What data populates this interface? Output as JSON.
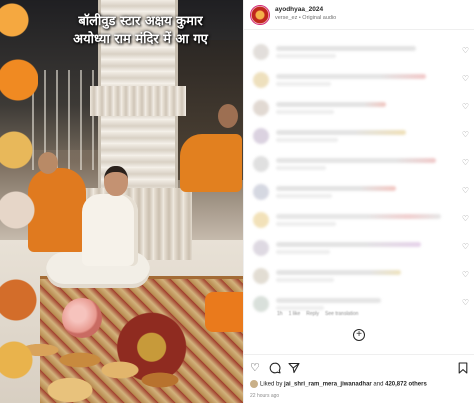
{
  "media": {
    "overlay_line1": "बॉलीवुड स्टार अक्षय कुमार",
    "overlay_line2": "अयोध्या राम मंदिर में आ गए"
  },
  "header": {
    "username": "ayodhyaa_2024",
    "subline": "verse_ez • Original audio"
  },
  "comments": {
    "meta_time": "1h",
    "meta_like": "1 like",
    "meta_reply": "Reply",
    "meta_translation": "See translation"
  },
  "actions": {
    "like_icon": "heart-icon",
    "comment_icon": "comment-icon",
    "share_icon": "share-icon",
    "save_icon": "bookmark-icon"
  },
  "likes": {
    "prefix": "Liked by",
    "user": "jai_shri_ram_mera_jiwanadhar",
    "and": "and",
    "others": "420,872 others"
  },
  "timestamp": "22 hours ago"
}
